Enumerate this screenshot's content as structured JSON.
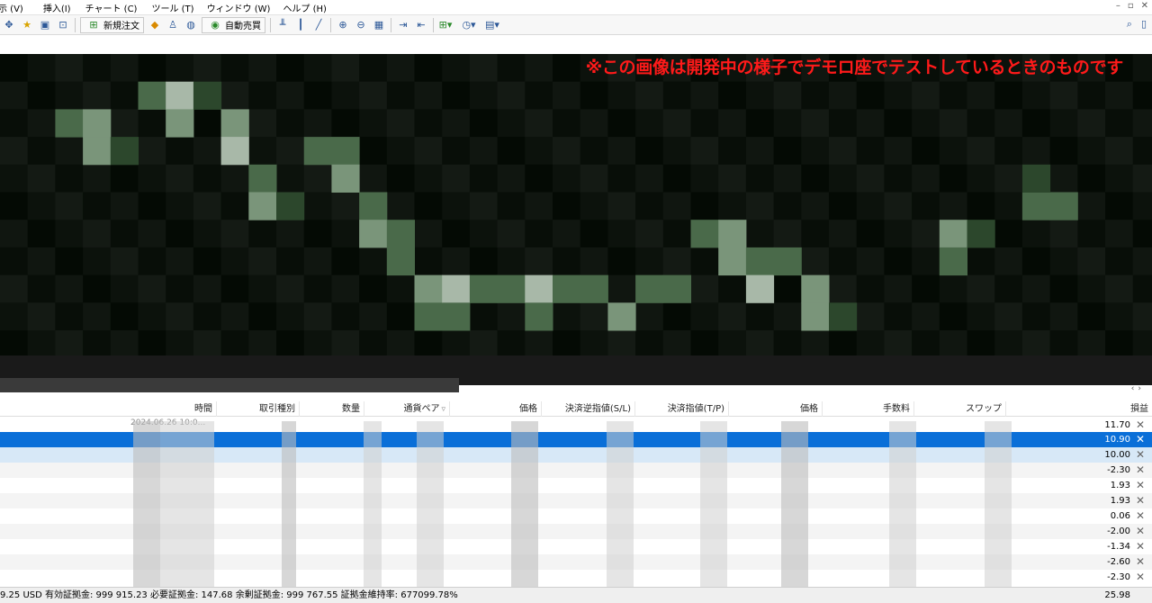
{
  "menu": [
    "示 (V)",
    "挿入(I)",
    "チャート (C)",
    "ツール (T)",
    "ウィンドウ (W)",
    "ヘルプ (H)"
  ],
  "toolbar": {
    "new_order_label": "新規注文",
    "auto_trade_label": "自動売買"
  },
  "chart": {
    "note": "※この画像は開発中の様子でデモロ座でテストしているときのものです"
  },
  "table": {
    "headers": [
      "時間",
      "取引種別",
      "数量",
      "通貨ペア",
      "価格",
      "決済逆指値(S/L)",
      "決済指値(T/P)",
      "価格",
      "手数料",
      "スワップ",
      "損益"
    ],
    "first_row_time_fragment": "2024.06.26 10:0...",
    "profits": [
      "11.70",
      "10.90",
      "10.00",
      "-2.30",
      "1.93",
      "1.93",
      "0.06",
      "-2.00",
      "-1.34",
      "-2.60",
      "-2.30"
    ]
  },
  "status": {
    "text": "9.25 USD  有効証拠金: 999 915.23  必要証拠金: 147.68  余剰証拠金: 999 767.55  証拠金維持率: 677099.78%",
    "total": "25.98"
  },
  "colors": {
    "selected_row": "#0a6fd8",
    "note_red": "#ff1a1a",
    "candle_green": "#6f8f6f"
  }
}
